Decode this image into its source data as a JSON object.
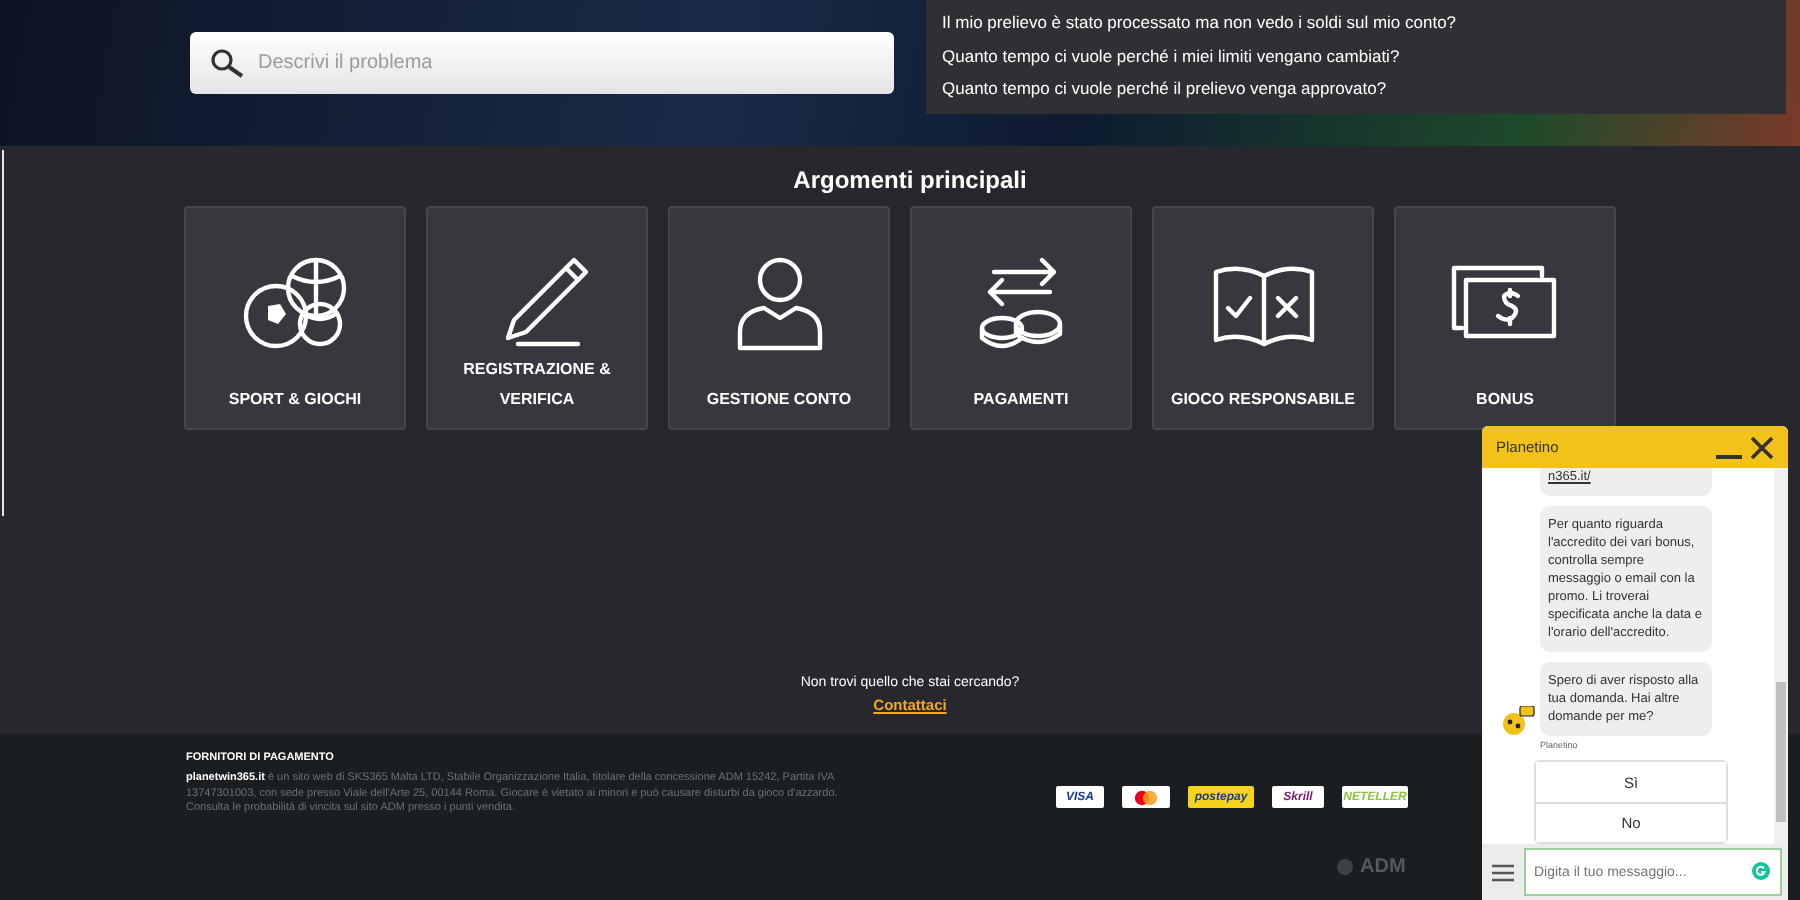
{
  "search": {
    "placeholder": "Descrivi il problema"
  },
  "suggestions": [
    "Il mio prelievo è stato processato ma non vedo i soldi sul mio conto?",
    "Quanto tempo ci vuole perché i miei limiti vengano cambiati?",
    "Quanto tempo ci vuole perché il prelievo venga approvato?"
  ],
  "topics": {
    "title": "Argomenti principali",
    "items": [
      {
        "label": "SPORT & GIOCHI",
        "kind": "sport"
      },
      {
        "label": "REGISTRAZIONE & VERIFICA",
        "kind": "pen"
      },
      {
        "label": "GESTIONE CONTO",
        "kind": "person"
      },
      {
        "label": "PAGAMENTI",
        "kind": "coins"
      },
      {
        "label": "GIOCO RESPONSABILE",
        "kind": "book"
      },
      {
        "label": "BONUS",
        "kind": "money"
      }
    ]
  },
  "help": {
    "question": "Non trovi quello che stai cercando?",
    "link": "Contattaci"
  },
  "footer": {
    "heading": "FORNITORI DI PAGAMENTO",
    "legal": "**planetwin365.it** è un sito web di SKS365 Malta LTD, Stabile Organizzazione Italia, titolare della concessione ADM 15242, Partita IVA 13747301003, con sede presso Viale dell'Arte 25, 00144 Roma. Giocare è vietato ai minori e può causare disturbi da gioco d'azzardo. Consulta le probabilità di vincita sul sito ADM presso i punti vendita.",
    "payments": [
      {
        "kind": "visa",
        "label": "VISA"
      },
      {
        "kind": "mastercard"
      },
      {
        "kind": "postepay",
        "label": "postepay"
      },
      {
        "kind": "skrill",
        "label": "Skrill"
      },
      {
        "kind": "neteller",
        "label": "NETELLER"
      }
    ],
    "regulator": "ADM"
  },
  "chat": {
    "title": "Planetino",
    "messages": [
      {
        "kind": "link",
        "text": "n365.it/"
      },
      {
        "kind": "text",
        "text": "Per quanto riguarda l'accredito dei vari bonus, controlla sempre messaggio o email con la promo. Li troverai specificata anche la data e l'orario dell'accredito."
      },
      {
        "kind": "text",
        "text": "Spero di aver risposto alla tua domanda. Hai altre domande per me?"
      }
    ],
    "sender": "Planetino",
    "options": [
      "Sì",
      "No"
    ],
    "input": {
      "placeholder": "Digita il tuo messaggio..."
    }
  }
}
